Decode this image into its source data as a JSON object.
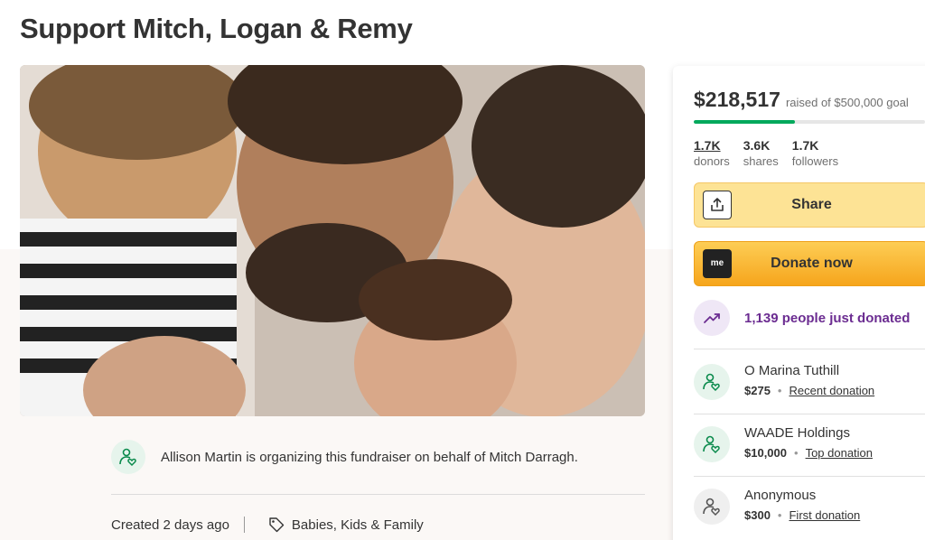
{
  "page": {
    "title": "Support Mitch, Logan & Remy"
  },
  "organizer": {
    "text": "Allison Martin is organizing this fundraiser on behalf of Mitch Darragh.",
    "icon": "heart-person-icon"
  },
  "meta": {
    "created": "Created 2 days ago",
    "category": "Babies, Kids & Family",
    "category_icon": "tag-icon"
  },
  "donation_card": {
    "raised": "$218,517",
    "goal_text": "raised of $500,000 goal",
    "progress_fraction": 0.437,
    "stats": [
      {
        "value": "1.7K",
        "label": "donors"
      },
      {
        "value": "3.6K",
        "label": "shares"
      },
      {
        "value": "1.7K",
        "label": "followers"
      }
    ],
    "share_label": "Share",
    "donate_label": "Donate now",
    "donate_icon_text": "me",
    "trend_text": "1,139 people just donated",
    "donations": [
      {
        "name": "O Marina Tuthill",
        "amount": "$275",
        "kind": "Recent donation"
      },
      {
        "name": "WAADE Holdings",
        "amount": "$10,000",
        "kind": "Top donation"
      },
      {
        "name": "Anonymous",
        "amount": "$300",
        "kind": "First donation"
      }
    ]
  },
  "colors": {
    "accent_green": "#02a95c",
    "share_yellow": "#fde395",
    "donate_orange": "#f6a51c",
    "trend_purple": "#6b2c91"
  }
}
